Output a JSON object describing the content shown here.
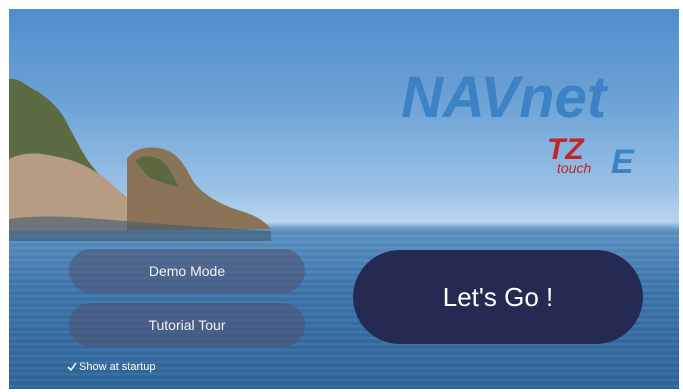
{
  "app": {
    "logo_main": "NAVnet",
    "logo_sub": "touch",
    "logo_badge_left": "TZ",
    "logo_badge_right": "E",
    "colors": {
      "logo_blue": "#3d82c4",
      "logo_red": "#c4232c",
      "logo_white": "#ffffff",
      "go_button": "#252a52"
    }
  },
  "menu": {
    "demo_label": "Demo Mode",
    "tour_label": "Tutorial Tour",
    "go_label": "Let's Go !"
  },
  "startup": {
    "label": "Show at startup",
    "checked": true
  }
}
